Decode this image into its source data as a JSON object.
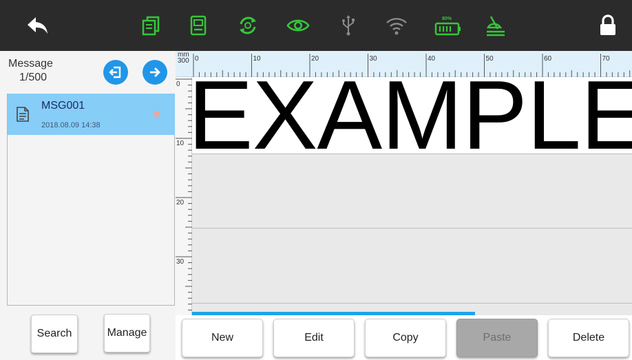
{
  "colors": {
    "toolbar_bg": "#2b2b2b",
    "icon_green": "#36c63a",
    "icon_gray": "#8a8a8a",
    "accent_blue": "#2196e8",
    "selected_item": "#86cdf7"
  },
  "toolbar": {
    "icons": [
      "back-icon",
      "files-icon",
      "device-icon",
      "refresh-icon",
      "eye-icon",
      "usb-icon",
      "wifi-icon",
      "battery-icon",
      "ink-icon",
      "lock-icon"
    ],
    "battery_label": "80%"
  },
  "messages": {
    "title": "Message",
    "count": "1/500",
    "items": [
      {
        "name": "MSG001",
        "date": "2018.08.09 14:38"
      }
    ]
  },
  "left_buttons": {
    "search": "Search",
    "manage": "Manage"
  },
  "editor": {
    "text": "EXAMPLE",
    "unit": "mm",
    "height_value": "300",
    "ruler_x": [
      "0",
      "10",
      "20",
      "30",
      "40",
      "50",
      "60",
      "70"
    ],
    "ruler_y": [
      "0",
      "10",
      "20",
      "30"
    ],
    "progress": 0.62
  },
  "bottom_buttons": {
    "new": "New",
    "edit": "Edit",
    "copy": "Copy",
    "paste": "Paste",
    "delete": "Delete"
  }
}
